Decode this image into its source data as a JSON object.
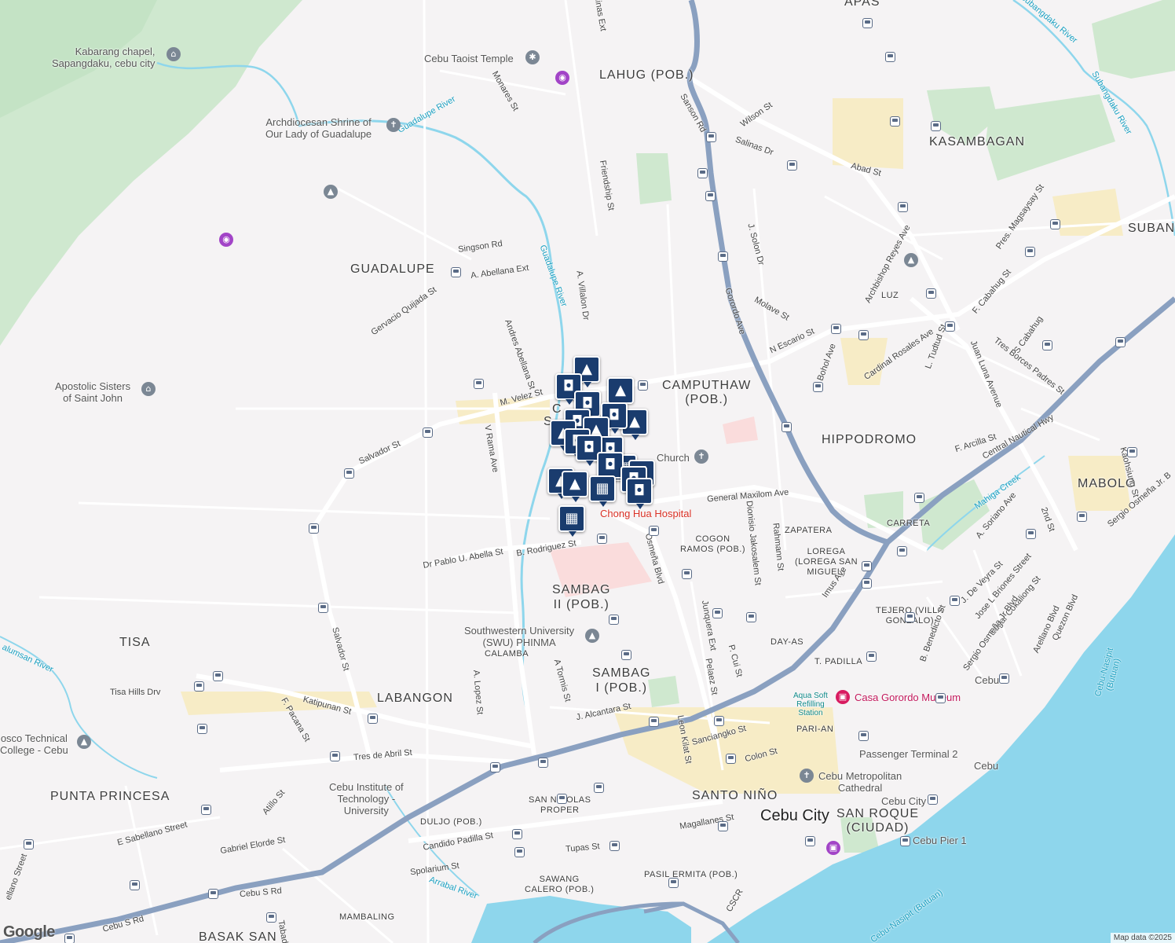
{
  "map": {
    "attribution": "Map data ©2025",
    "logo": "Google",
    "marker_icons": {
      "shopping": "shopping-bag-icon",
      "school": "graduation-cap-icon",
      "grocery": "shopping-cart-icon"
    }
  },
  "areas": {
    "apas": "APAS",
    "lahug": "LAHUG (POB.)",
    "kasambagan": "KASAMBAGAN",
    "subang": "SUBANG",
    "guadalupe": "GUADALUPE",
    "luz": "LUZ",
    "camputhaw_1": "CAMPUTHAW",
    "camputhaw_2": "(POB.)",
    "hippodromo": "HIPPODROMO",
    "mabolo": "MABOLO",
    "carreta": "CARRETA",
    "zapatera": "ZAPATERA",
    "cogon_ramos_1": "COGON",
    "cogon_ramos_2": "RAMOS (POB.)",
    "lorega_1": "LOREGA",
    "lorega_2": "(LOREGA SAN",
    "lorega_3": "MIGUEL)",
    "sambag2_1": "SAMBAG",
    "sambag2_2": "II (POB.)",
    "tejero_1": "TEJERO (VILLA",
    "tejero_2": "GONZALO)",
    "tisa": "TISA",
    "calamba": "CALAMBA",
    "sambag1_1": "SAMBAG",
    "sambag1_2": "I (POB.)",
    "day_as": "DAY-AS",
    "t_padilla": "T. PADILLA",
    "labangon": "LABANGON",
    "pari_an": "PARI-AN",
    "punta_princesa": "PUNTA PRINCESA",
    "san_nicolas_1": "SAN NICOLAS",
    "san_nicolas_2": "PROPER",
    "santo_nino": "SANTO NIÑO",
    "cebu_city": "Cebu City",
    "san_roque_1": "SAN ROQUE",
    "san_roque_2": "(CIUDAD)",
    "duljo": "DULJO (POB.)",
    "sawang_calero_1": "SAWANG",
    "sawang_calero_2": "CALERO (POB.)",
    "pasil": "PASIL",
    "ermita": "ERMITA (POB.)",
    "mambaling": "MAMBALING",
    "basak_san": "BASAK SAN",
    "c_partial": "C",
    "s_partial": "S"
  },
  "pois": {
    "kabarang_chapel_1": "Kabarang chapel,",
    "kabarang_chapel_2": "Sapangdaku, cebu city",
    "taoist_temple": "Cebu Taoist Temple",
    "guadalupe_shrine_1": "Archdiocesan Shrine of",
    "guadalupe_shrine_2": "Our Lady of Guadalupe",
    "apostolic_sisters_1": "Apostolic Sisters",
    "apostolic_sisters_2": "of Saint John",
    "church": "Church",
    "chong_hua": "Chong Hua Hospital",
    "swu_1": "Southwestern University",
    "swu_2": "(SWU) PHINMA",
    "casa_gorordo": "Casa Gorordo Museum",
    "aqua_soft_1": "Aqua Soft",
    "aqua_soft_2": "Refilling",
    "aqua_soft_3": "Station",
    "don_bosco_1": "osco Technical",
    "don_bosco_2": "College - Cebu",
    "cit_1": "Cebu Institute of",
    "cit_2": "Technology -",
    "cit_3": "University",
    "passenger_terminal": "Passenger Terminal 2",
    "cebu_port": "Cebu",
    "metropolitan_cathedral_1": "Cebu Metropolitan",
    "metropolitan_cathedral_2": "Cathedral",
    "cebu_city_poi": "Cebu City",
    "cebu_pier": "Cebu Pier 1",
    "cebu_1": "Cebu"
  },
  "rivers": {
    "guadalupe_river_1": "Guadalupe River",
    "guadalupe_river_2": "Guadalupe River",
    "subangdaku_river_1": "Subangdaku River",
    "subangdaku_river_2": "Subangdaku River",
    "mahiga_creek": "Mahiga Creek",
    "kinalumsan_river": "alumsan River",
    "arrabal_river": "Arrabal River",
    "cebu_nasipit_1": "Cebu-Nasipit",
    "cebu_nasipit_1b": "(Butuan)",
    "cebu_nasipit_2": "Cebu-Nasipit (Butuan)"
  },
  "streets": {
    "salinas_ext": "alinas Ext",
    "monares": "Monares St",
    "sanson": "Sanson Rd",
    "wilson": "Wilson St",
    "salinas_dr": "Salinas Dr",
    "abad": "Abad St",
    "friendship": "Friendship St",
    "singson": "Singson Rd",
    "a_abellana_ext": "A. Abellana Ext",
    "j_solon": "J. Solon Dr",
    "pres_magsaysay": "Pres. Magsaysay St",
    "gervacio": "Gervacio Quijada St",
    "a_villalon": "A. Villalon Dr",
    "gorordo": "Gorordo Ave",
    "molave": "Molave St",
    "archbishop_reyes": "Archbishop Reyes Ave",
    "f_cabahug": "F. Cabahug St",
    "andres_abellana": "Andres Abellana St",
    "n_escario": "N Escario St",
    "bohol_ave": "Bohol Ave",
    "cardinal_rosales": "Cardinal Rosales Ave",
    "l_tudtud": "L. Tudtud St",
    "juan_luna": "Juan Luna Avenue",
    "s_cabahug": "S Cabahug",
    "tres_borces": "Tres Borces Padres St",
    "m_velez": "M. Velez St",
    "salvador_1": "Salvador St",
    "v_rama": "V Rama Ave",
    "f_arcilla": "F. Arcilla St",
    "central_nautical": "Central Nautical Hwy",
    "kaohsiung": "Kaohsiung St",
    "sergio_osmena_top": "Sergio Osmeña Jr. B",
    "general_maxilom": "General Maxilom Ave",
    "dionisio_jakosalem": "Dionisio Jakosalem St",
    "rahmann": "Rahmann St",
    "a_soriano": "A. Soriano Ave",
    "second_st": "2nd St",
    "b_rodriguez": "B. Rodriguez St",
    "osmena_blvd": "Osmeña Blvd",
    "dr_pablo": "Dr Pablo U. Abella St",
    "imus": "Imus Ave",
    "j_de_veyra": "J. De Veyra St",
    "jose_l_briones": "Jose L Briones Street",
    "edgar_cokaliong": "Edgar Cokaliong St",
    "salvador_2": "Salvador St",
    "junquera": "Junquera Ext",
    "b_benedicto": "B. Benedicto St",
    "sergio_osmena_jr": "Sergio Osmeña Jr Blvd",
    "arellano": "Arellano Blvd",
    "quezon": "Quezon Blvd",
    "a_tormis": "A Tormis St",
    "pelaez": "Pelaez St",
    "p_cui": "P. Cui St",
    "a_lopez": "A. Lopez St",
    "tisa_hills": "Tisa Hills Drv",
    "katipunan": "Katipunan St",
    "f_pacana": "F. Pacana St",
    "j_alcantara": "J. Alcantara St",
    "leon_kilat": "Leon Kilat St",
    "sanciangko": "Sanciangko St",
    "tres_de_abril": "Tres de Abril St",
    "colon": "Colon St",
    "atillo": "Atillo St",
    "e_sabellano": "E Sabellano Street",
    "magallanes": "Magallanes St",
    "gabriel_elorde": "Gabriel Elorde St",
    "candido_padilla": "Candido Padilla St",
    "tupas": "Tupas St",
    "spolarium": "Spolarium St",
    "cebu_s_rd_1": "Cebu S Rd",
    "cebu_s_rd_2": "Cebu S Rd",
    "cscr": "CSCR",
    "sabellano_partial": "ellano Street",
    "tabada_partial": "Tabad"
  },
  "colors": {
    "land": "#f5f3f4",
    "park": "#cfe8cf",
    "water": "#8ed6ec",
    "highway": "#8aa0c0",
    "commercial": "#f7ecc6",
    "medical": "#fadcdc",
    "marker": "#1a3c6e"
  }
}
